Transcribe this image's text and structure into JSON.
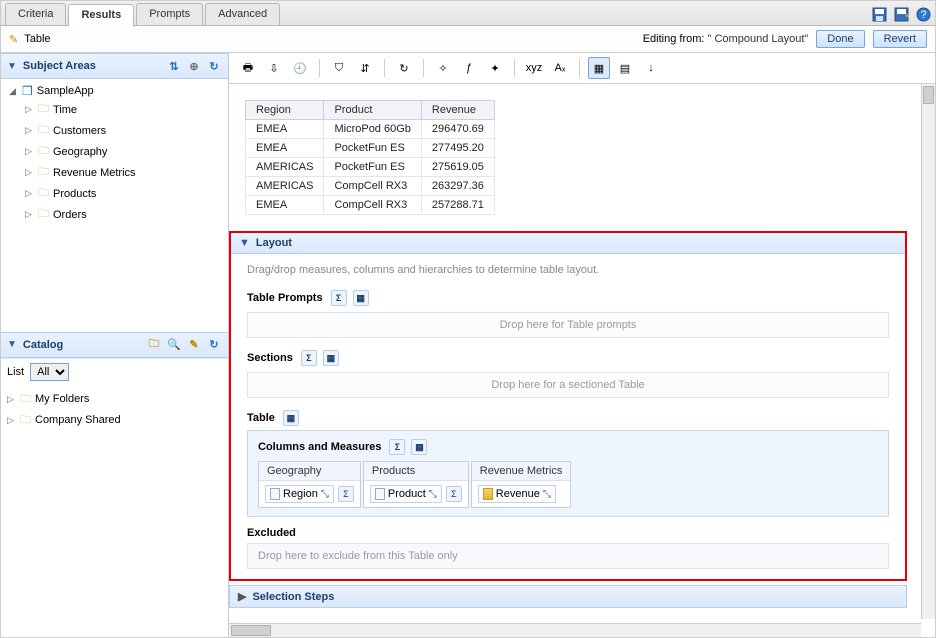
{
  "tabs": {
    "criteria": "Criteria",
    "results": "Results",
    "prompts": "Prompts",
    "advanced": "Advanced"
  },
  "subheader": {
    "title": "Table",
    "editing_prefix": "Editing from: ",
    "editing_name": "\" Compound Layout\"",
    "done": "Done",
    "revert": "Revert"
  },
  "left": {
    "subject_areas_title": "Subject Areas",
    "catalog_title": "Catalog",
    "list_label": "List",
    "list_value": "All",
    "list_options": [
      "All"
    ],
    "tree": {
      "root": "SampleApp",
      "children": [
        "Time",
        "Customers",
        "Geography",
        "Revenue Metrics",
        "Products",
        "Orders"
      ]
    },
    "catalog_tree": [
      "My Folders",
      "Company Shared"
    ]
  },
  "table": {
    "headers": [
      "Region",
      "Product",
      "Revenue"
    ],
    "rows": [
      {
        "region": "EMEA",
        "product": "MicroPod 60Gb",
        "revenue": "296470.69"
      },
      {
        "region": "EMEA",
        "product": "PocketFun ES",
        "revenue": "277495.20"
      },
      {
        "region": "AMERICAS",
        "product": "PocketFun ES",
        "revenue": "275619.05"
      },
      {
        "region": "AMERICAS",
        "product": "CompCell RX3",
        "revenue": "263297.36"
      },
      {
        "region": "EMEA",
        "product": "CompCell RX3",
        "revenue": "257288.71"
      }
    ]
  },
  "layout": {
    "title": "Layout",
    "hint": "Drag/drop measures, columns and hierarchies to determine table layout.",
    "table_prompts_label": "Table Prompts",
    "table_prompts_drop": "Drop here for Table prompts",
    "sections_label": "Sections",
    "sections_drop": "Drop here for a sectioned Table",
    "table_label": "Table",
    "columns_measures_label": "Columns and Measures",
    "cols": [
      {
        "group": "Geography",
        "item": "Region"
      },
      {
        "group": "Products",
        "item": "Product"
      },
      {
        "group": "Revenue Metrics",
        "item": "Revenue"
      }
    ],
    "excluded_label": "Excluded",
    "excluded_drop": "Drop here to exclude from this Table only"
  },
  "selection_steps_title": "Selection Steps"
}
